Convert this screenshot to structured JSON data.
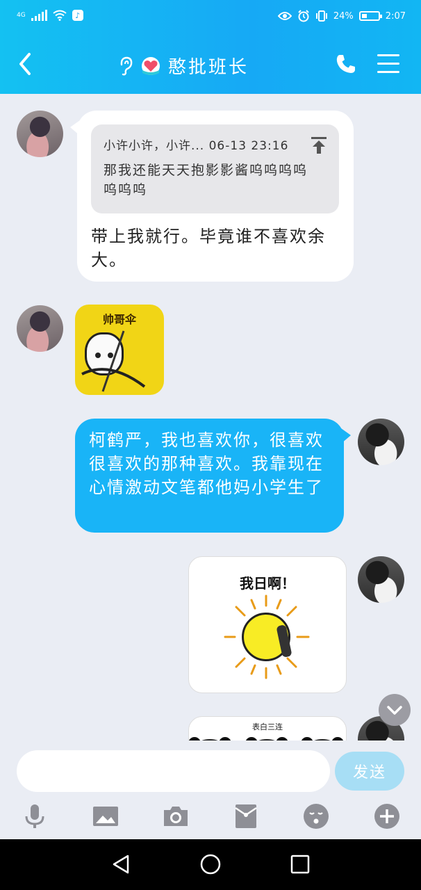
{
  "status_bar": {
    "network": "4G",
    "battery": "24%",
    "time": "2:07"
  },
  "header": {
    "title": "憨批班长"
  },
  "messages": {
    "quote_meta": "小许小许，小许... 06-13 23:16",
    "quote_text": "那我还能天天抱影影酱呜呜呜呜呜呜呜",
    "reply": "带上我就行。毕竟谁不喜欢余大。",
    "sticker1_label": "帅哥伞",
    "sent1": "柯鹤严，我也喜欢你，很喜欢很喜欢的那种喜欢。我靠现在心情激动文笔都他妈小学生了",
    "sticker2_label": "我日啊！",
    "sticker3_label": "表白三连"
  },
  "input": {
    "placeholder": "",
    "send_label": "发送"
  },
  "colors": {
    "header_gradient_start": "#14c1f2",
    "header_gradient_end": "#16a9f5",
    "sent_bubble": "#19b4f7",
    "send_button": "#a7def5",
    "background": "#eaedf4"
  }
}
